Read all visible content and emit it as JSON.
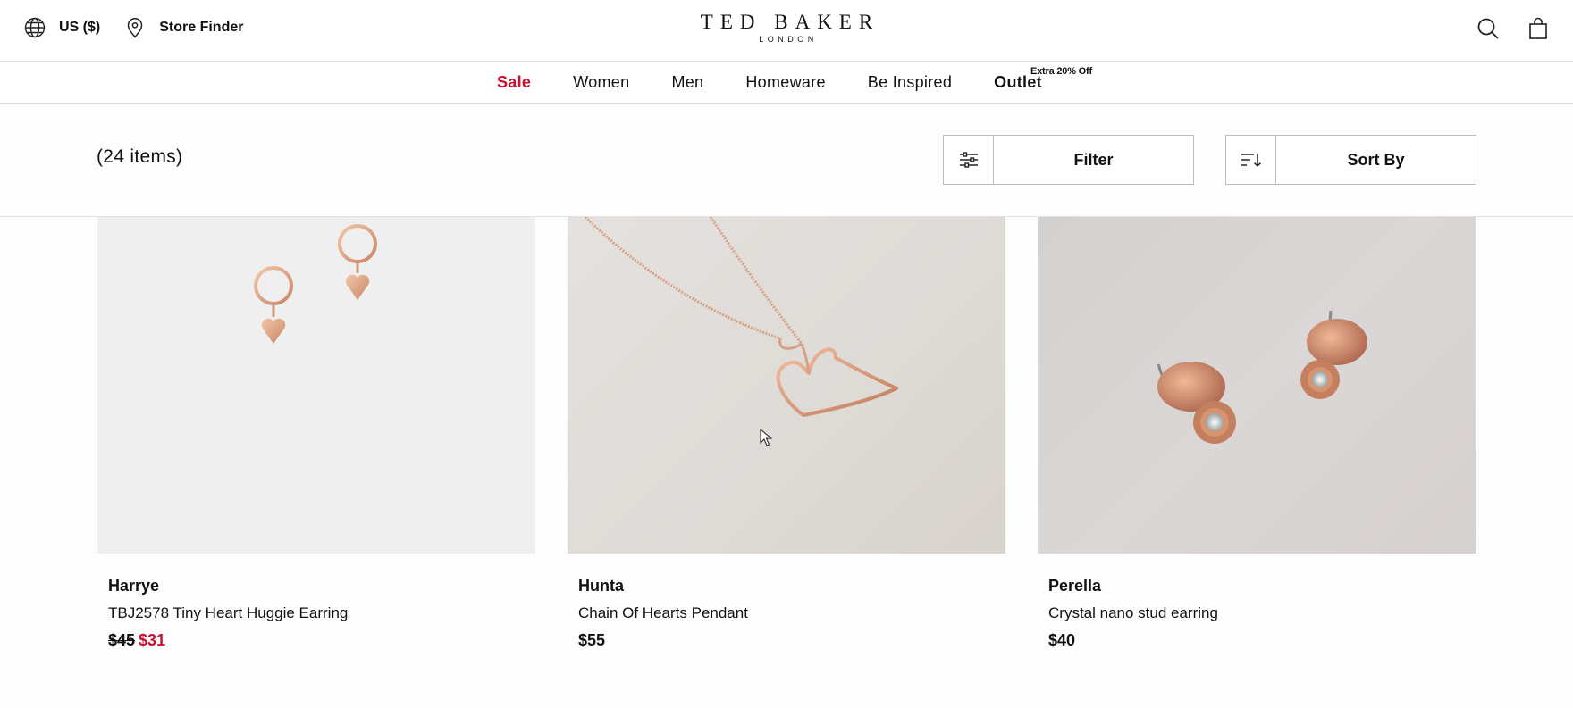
{
  "header": {
    "region_label": "US ($)",
    "store_finder_label": "Store Finder",
    "logo_brand": "TED BAKER",
    "logo_city": "LONDON",
    "icons": [
      "globe-icon",
      "location-pin-icon",
      "search-icon",
      "shopping-bag-icon"
    ]
  },
  "nav": {
    "items": [
      {
        "label": "Sale"
      },
      {
        "label": "Women"
      },
      {
        "label": "Men"
      },
      {
        "label": "Homeware"
      },
      {
        "label": "Be Inspired"
      },
      {
        "label": "Outlet"
      }
    ],
    "outlet_promo": "Extra 20% Off",
    "sale_color": "#c8102e"
  },
  "listing": {
    "count_label": "(24 items)",
    "filter_label": "Filter",
    "sort_label": "Sort By"
  },
  "products": [
    {
      "brand": "Harrye",
      "title": "TBJ2578 Tiny Heart Huggie Earring",
      "old_price": "$45",
      "price": "$31"
    },
    {
      "brand": "Hunta",
      "title": "Chain Of Hearts Pendant",
      "price": "$55"
    },
    {
      "brand": "Perella",
      "title": "Crystal nano stud earring",
      "price": "$40"
    }
  ]
}
